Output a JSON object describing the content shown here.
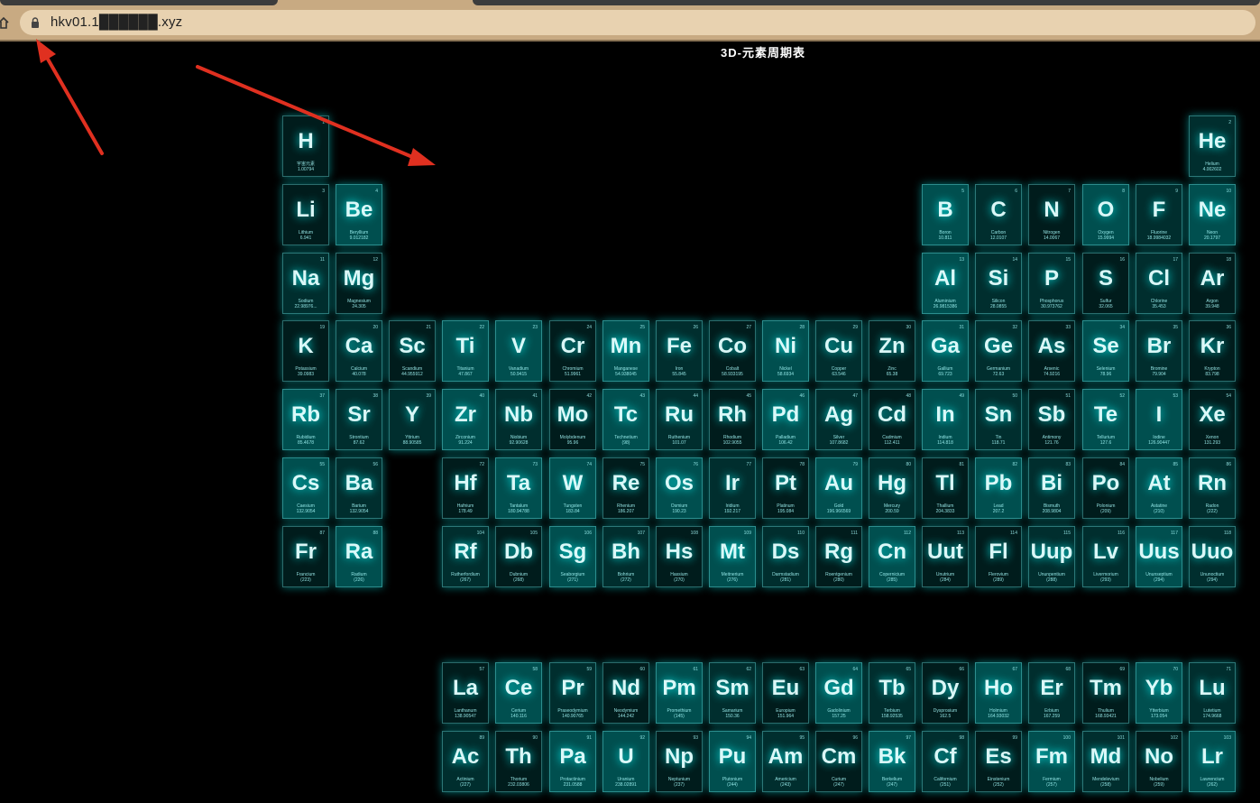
{
  "browser": {
    "url": "hkv01.1██████.xyz"
  },
  "page": {
    "title": "3D-元素周期表"
  },
  "colors": {
    "tile_bright": "#007f7f",
    "glow": "#00ffff",
    "symbol_text": "#e6ffff",
    "arrow": "#e03020",
    "browser_chrome": "#c8aa82"
  },
  "elements": [
    {
      "n": "1",
      "s": "H",
      "name": "宇宙元素",
      "m": "1.00794",
      "row": 1,
      "col": 1
    },
    {
      "n": "2",
      "s": "He",
      "name": "Helium",
      "m": "4.002602",
      "row": 1,
      "col": 18
    },
    {
      "n": "3",
      "s": "Li",
      "name": "Lithium",
      "m": "6.941",
      "row": 2,
      "col": 1
    },
    {
      "n": "4",
      "s": "Be",
      "name": "Beryllium",
      "m": "9.012182",
      "row": 2,
      "col": 2
    },
    {
      "n": "5",
      "s": "B",
      "name": "Boron",
      "m": "10.811",
      "row": 2,
      "col": 13
    },
    {
      "n": "6",
      "s": "C",
      "name": "Carbon",
      "m": "12.0107",
      "row": 2,
      "col": 14
    },
    {
      "n": "7",
      "s": "N",
      "name": "Nitrogen",
      "m": "14.0067",
      "row": 2,
      "col": 15
    },
    {
      "n": "8",
      "s": "O",
      "name": "Oxygen",
      "m": "15.9994",
      "row": 2,
      "col": 16
    },
    {
      "n": "9",
      "s": "F",
      "name": "Fluorine",
      "m": "18.9984032",
      "row": 2,
      "col": 17
    },
    {
      "n": "10",
      "s": "Ne",
      "name": "Neon",
      "m": "20.1797",
      "row": 2,
      "col": 18
    },
    {
      "n": "11",
      "s": "Na",
      "name": "Sodium",
      "m": "22.98976...",
      "row": 3,
      "col": 1
    },
    {
      "n": "12",
      "s": "Mg",
      "name": "Magnesium",
      "m": "24.305",
      "row": 3,
      "col": 2
    },
    {
      "n": "13",
      "s": "Al",
      "name": "Aluminium",
      "m": "26.9815386",
      "row": 3,
      "col": 13
    },
    {
      "n": "14",
      "s": "Si",
      "name": "Silicon",
      "m": "28.0855",
      "row": 3,
      "col": 14
    },
    {
      "n": "15",
      "s": "P",
      "name": "Phosphorus",
      "m": "30.973762",
      "row": 3,
      "col": 15
    },
    {
      "n": "16",
      "s": "S",
      "name": "Sulfur",
      "m": "32.065",
      "row": 3,
      "col": 16
    },
    {
      "n": "17",
      "s": "Cl",
      "name": "Chlorine",
      "m": "35.453",
      "row": 3,
      "col": 17
    },
    {
      "n": "18",
      "s": "Ar",
      "name": "Argon",
      "m": "39.948",
      "row": 3,
      "col": 18
    },
    {
      "n": "19",
      "s": "K",
      "name": "Potassium",
      "m": "39.0983",
      "row": 4,
      "col": 1
    },
    {
      "n": "20",
      "s": "Ca",
      "name": "Calcium",
      "m": "40.078",
      "row": 4,
      "col": 2
    },
    {
      "n": "21",
      "s": "Sc",
      "name": "Scandium",
      "m": "44.955912",
      "row": 4,
      "col": 3
    },
    {
      "n": "22",
      "s": "Ti",
      "name": "Titanium",
      "m": "47.867",
      "row": 4,
      "col": 4
    },
    {
      "n": "23",
      "s": "V",
      "name": "Vanadium",
      "m": "50.9415",
      "row": 4,
      "col": 5
    },
    {
      "n": "24",
      "s": "Cr",
      "name": "Chromium",
      "m": "51.9961",
      "row": 4,
      "col": 6
    },
    {
      "n": "25",
      "s": "Mn",
      "name": "Manganese",
      "m": "54.938045",
      "row": 4,
      "col": 7
    },
    {
      "n": "26",
      "s": "Fe",
      "name": "Iron",
      "m": "55.845",
      "row": 4,
      "col": 8
    },
    {
      "n": "27",
      "s": "Co",
      "name": "Cobalt",
      "m": "58.933195",
      "row": 4,
      "col": 9
    },
    {
      "n": "28",
      "s": "Ni",
      "name": "Nickel",
      "m": "58.6934",
      "row": 4,
      "col": 10
    },
    {
      "n": "29",
      "s": "Cu",
      "name": "Copper",
      "m": "63.546",
      "row": 4,
      "col": 11
    },
    {
      "n": "30",
      "s": "Zn",
      "name": "Zinc",
      "m": "65.38",
      "row": 4,
      "col": 12
    },
    {
      "n": "31",
      "s": "Ga",
      "name": "Gallium",
      "m": "69.723",
      "row": 4,
      "col": 13
    },
    {
      "n": "32",
      "s": "Ge",
      "name": "Germanium",
      "m": "72.63",
      "row": 4,
      "col": 14
    },
    {
      "n": "33",
      "s": "As",
      "name": "Arsenic",
      "m": "74.9216",
      "row": 4,
      "col": 15
    },
    {
      "n": "34",
      "s": "Se",
      "name": "Selenium",
      "m": "78.96",
      "row": 4,
      "col": 16
    },
    {
      "n": "35",
      "s": "Br",
      "name": "Bromine",
      "m": "79.904",
      "row": 4,
      "col": 17
    },
    {
      "n": "36",
      "s": "Kr",
      "name": "Krypton",
      "m": "83.798",
      "row": 4,
      "col": 18
    },
    {
      "n": "37",
      "s": "Rb",
      "name": "Rubidium",
      "m": "85.4678",
      "row": 5,
      "col": 1
    },
    {
      "n": "38",
      "s": "Sr",
      "name": "Strontium",
      "m": "87.62",
      "row": 5,
      "col": 2
    },
    {
      "n": "39",
      "s": "Y",
      "name": "Yttrium",
      "m": "88.90585",
      "row": 5,
      "col": 3
    },
    {
      "n": "40",
      "s": "Zr",
      "name": "Zirconium",
      "m": "91.224",
      "row": 5,
      "col": 4
    },
    {
      "n": "41",
      "s": "Nb",
      "name": "Niobium",
      "m": "92.90628",
      "row": 5,
      "col": 5
    },
    {
      "n": "42",
      "s": "Mo",
      "name": "Molybdenum",
      "m": "95.96",
      "row": 5,
      "col": 6
    },
    {
      "n": "43",
      "s": "Tc",
      "name": "Technetium",
      "m": "(98)",
      "row": 5,
      "col": 7
    },
    {
      "n": "44",
      "s": "Ru",
      "name": "Ruthenium",
      "m": "101.07",
      "row": 5,
      "col": 8
    },
    {
      "n": "45",
      "s": "Rh",
      "name": "Rhodium",
      "m": "102.9055",
      "row": 5,
      "col": 9
    },
    {
      "n": "46",
      "s": "Pd",
      "name": "Palladium",
      "m": "106.42",
      "row": 5,
      "col": 10
    },
    {
      "n": "47",
      "s": "Ag",
      "name": "Silver",
      "m": "107.8682",
      "row": 5,
      "col": 11
    },
    {
      "n": "48",
      "s": "Cd",
      "name": "Cadmium",
      "m": "112.411",
      "row": 5,
      "col": 12
    },
    {
      "n": "49",
      "s": "In",
      "name": "Indium",
      "m": "114.818",
      "row": 5,
      "col": 13
    },
    {
      "n": "50",
      "s": "Sn",
      "name": "Tin",
      "m": "118.71",
      "row": 5,
      "col": 14
    },
    {
      "n": "51",
      "s": "Sb",
      "name": "Antimony",
      "m": "121.76",
      "row": 5,
      "col": 15
    },
    {
      "n": "52",
      "s": "Te",
      "name": "Tellurium",
      "m": "127.6",
      "row": 5,
      "col": 16
    },
    {
      "n": "53",
      "s": "I",
      "name": "Iodine",
      "m": "126.90447",
      "row": 5,
      "col": 17
    },
    {
      "n": "54",
      "s": "Xe",
      "name": "Xenon",
      "m": "131.293",
      "row": 5,
      "col": 18
    },
    {
      "n": "55",
      "s": "Cs",
      "name": "Caesium",
      "m": "132.9054",
      "row": 6,
      "col": 1
    },
    {
      "n": "56",
      "s": "Ba",
      "name": "Barium",
      "m": "132.9054",
      "row": 6,
      "col": 2
    },
    {
      "n": "72",
      "s": "Hf",
      "name": "Hafnium",
      "m": "178.49",
      "row": 6,
      "col": 4
    },
    {
      "n": "73",
      "s": "Ta",
      "name": "Tantalum",
      "m": "180.94788",
      "row": 6,
      "col": 5
    },
    {
      "n": "74",
      "s": "W",
      "name": "Tungsten",
      "m": "183.84",
      "row": 6,
      "col": 6
    },
    {
      "n": "75",
      "s": "Re",
      "name": "Rhenium",
      "m": "186.207",
      "row": 6,
      "col": 7
    },
    {
      "n": "76",
      "s": "Os",
      "name": "Osmium",
      "m": "190.23",
      "row": 6,
      "col": 8
    },
    {
      "n": "77",
      "s": "Ir",
      "name": "Iridium",
      "m": "192.217",
      "row": 6,
      "col": 9
    },
    {
      "n": "78",
      "s": "Pt",
      "name": "Platinum",
      "m": "195.084",
      "row": 6,
      "col": 10
    },
    {
      "n": "79",
      "s": "Au",
      "name": "Gold",
      "m": "196.966569",
      "row": 6,
      "col": 11
    },
    {
      "n": "80",
      "s": "Hg",
      "name": "Mercury",
      "m": "200.59",
      "row": 6,
      "col": 12
    },
    {
      "n": "81",
      "s": "Tl",
      "name": "Thallium",
      "m": "204.3833",
      "row": 6,
      "col": 13
    },
    {
      "n": "82",
      "s": "Pb",
      "name": "Lead",
      "m": "207.2",
      "row": 6,
      "col": 14
    },
    {
      "n": "83",
      "s": "Bi",
      "name": "Bismuth",
      "m": "208.9804",
      "row": 6,
      "col": 15
    },
    {
      "n": "84",
      "s": "Po",
      "name": "Polonium",
      "m": "(209)",
      "row": 6,
      "col": 16
    },
    {
      "n": "85",
      "s": "At",
      "name": "Astatine",
      "m": "(210)",
      "row": 6,
      "col": 17
    },
    {
      "n": "86",
      "s": "Rn",
      "name": "Radon",
      "m": "(222)",
      "row": 6,
      "col": 18
    },
    {
      "n": "87",
      "s": "Fr",
      "name": "Francium",
      "m": "(223)",
      "row": 7,
      "col": 1
    },
    {
      "n": "88",
      "s": "Ra",
      "name": "Radium",
      "m": "(226)",
      "row": 7,
      "col": 2
    },
    {
      "n": "104",
      "s": "Rf",
      "name": "Rutherfordium",
      "m": "(267)",
      "row": 7,
      "col": 4
    },
    {
      "n": "105",
      "s": "Db",
      "name": "Dubnium",
      "m": "(268)",
      "row": 7,
      "col": 5
    },
    {
      "n": "106",
      "s": "Sg",
      "name": "Seaborgium",
      "m": "(271)",
      "row": 7,
      "col": 6
    },
    {
      "n": "107",
      "s": "Bh",
      "name": "Bohrium",
      "m": "(272)",
      "row": 7,
      "col": 7
    },
    {
      "n": "108",
      "s": "Hs",
      "name": "Hassium",
      "m": "(270)",
      "row": 7,
      "col": 8
    },
    {
      "n": "109",
      "s": "Mt",
      "name": "Meitnerium",
      "m": "(276)",
      "row": 7,
      "col": 9
    },
    {
      "n": "110",
      "s": "Ds",
      "name": "Darmstadium",
      "m": "(281)",
      "row": 7,
      "col": 10
    },
    {
      "n": "111",
      "s": "Rg",
      "name": "Roentgenium",
      "m": "(280)",
      "row": 7,
      "col": 11
    },
    {
      "n": "112",
      "s": "Cn",
      "name": "Copernicium",
      "m": "(285)",
      "row": 7,
      "col": 12
    },
    {
      "n": "113",
      "s": "Uut",
      "name": "Unutrium",
      "m": "(284)",
      "row": 7,
      "col": 13
    },
    {
      "n": "114",
      "s": "Fl",
      "name": "Flerovium",
      "m": "(289)",
      "row": 7,
      "col": 14
    },
    {
      "n": "115",
      "s": "Uup",
      "name": "Ununpentium",
      "m": "(288)",
      "row": 7,
      "col": 15
    },
    {
      "n": "116",
      "s": "Lv",
      "name": "Livermorium",
      "m": "(293)",
      "row": 7,
      "col": 16
    },
    {
      "n": "117",
      "s": "Uus",
      "name": "Ununseptium",
      "m": "(294)",
      "row": 7,
      "col": 17
    },
    {
      "n": "118",
      "s": "Uuo",
      "name": "Ununoctium",
      "m": "(294)",
      "row": 7,
      "col": 18
    },
    {
      "n": "57",
      "s": "La",
      "name": "Lanthanum",
      "m": "138.90547",
      "row": 9,
      "col": 4
    },
    {
      "n": "58",
      "s": "Ce",
      "name": "Cerium",
      "m": "140.116",
      "row": 9,
      "col": 5
    },
    {
      "n": "59",
      "s": "Pr",
      "name": "Praseodymium",
      "m": "140.90765",
      "row": 9,
      "col": 6
    },
    {
      "n": "60",
      "s": "Nd",
      "name": "Neodymium",
      "m": "144.242",
      "row": 9,
      "col": 7
    },
    {
      "n": "61",
      "s": "Pm",
      "name": "Promethium",
      "m": "(145)",
      "row": 9,
      "col": 8
    },
    {
      "n": "62",
      "s": "Sm",
      "name": "Samarium",
      "m": "150.36",
      "row": 9,
      "col": 9
    },
    {
      "n": "63",
      "s": "Eu",
      "name": "Europium",
      "m": "151.964",
      "row": 9,
      "col": 10
    },
    {
      "n": "64",
      "s": "Gd",
      "name": "Gadolinium",
      "m": "157.25",
      "row": 9,
      "col": 11
    },
    {
      "n": "65",
      "s": "Tb",
      "name": "Terbium",
      "m": "158.92535",
      "row": 9,
      "col": 12
    },
    {
      "n": "66",
      "s": "Dy",
      "name": "Dysprosium",
      "m": "162.5",
      "row": 9,
      "col": 13
    },
    {
      "n": "67",
      "s": "Ho",
      "name": "Holmium",
      "m": "164.93032",
      "row": 9,
      "col": 14
    },
    {
      "n": "68",
      "s": "Er",
      "name": "Erbium",
      "m": "167.259",
      "row": 9,
      "col": 15
    },
    {
      "n": "69",
      "s": "Tm",
      "name": "Thulium",
      "m": "168.93421",
      "row": 9,
      "col": 16
    },
    {
      "n": "70",
      "s": "Yb",
      "name": "Ytterbium",
      "m": "173.054",
      "row": 9,
      "col": 17
    },
    {
      "n": "71",
      "s": "Lu",
      "name": "Lutetium",
      "m": "174.9668",
      "row": 9,
      "col": 18
    },
    {
      "n": "89",
      "s": "Ac",
      "name": "Actinium",
      "m": "(227)",
      "row": 10,
      "col": 4
    },
    {
      "n": "90",
      "s": "Th",
      "name": "Thorium",
      "m": "232.03806",
      "row": 10,
      "col": 5
    },
    {
      "n": "91",
      "s": "Pa",
      "name": "Protactinium",
      "m": "231.0588",
      "row": 10,
      "col": 6
    },
    {
      "n": "92",
      "s": "U",
      "name": "Uranium",
      "m": "238.02891",
      "row": 10,
      "col": 7
    },
    {
      "n": "93",
      "s": "Np",
      "name": "Neptunium",
      "m": "(237)",
      "row": 10,
      "col": 8
    },
    {
      "n": "94",
      "s": "Pu",
      "name": "Plutonium",
      "m": "(244)",
      "row": 10,
      "col": 9
    },
    {
      "n": "95",
      "s": "Am",
      "name": "Americium",
      "m": "(243)",
      "row": 10,
      "col": 10
    },
    {
      "n": "96",
      "s": "Cm",
      "name": "Curium",
      "m": "(247)",
      "row": 10,
      "col": 11
    },
    {
      "n": "97",
      "s": "Bk",
      "name": "Berkelium",
      "m": "(247)",
      "row": 10,
      "col": 12
    },
    {
      "n": "98",
      "s": "Cf",
      "name": "Californium",
      "m": "(251)",
      "row": 10,
      "col": 13
    },
    {
      "n": "99",
      "s": "Es",
      "name": "Einstenium",
      "m": "(252)",
      "row": 10,
      "col": 14
    },
    {
      "n": "100",
      "s": "Fm",
      "name": "Fermium",
      "m": "(257)",
      "row": 10,
      "col": 15
    },
    {
      "n": "101",
      "s": "Md",
      "name": "Mendelevium",
      "m": "(258)",
      "row": 10,
      "col": 16
    },
    {
      "n": "102",
      "s": "No",
      "name": "Nobelium",
      "m": "(259)",
      "row": 10,
      "col": 17
    },
    {
      "n": "103",
      "s": "Lr",
      "name": "Lawrencium",
      "m": "(262)",
      "row": 10,
      "col": 18
    }
  ]
}
